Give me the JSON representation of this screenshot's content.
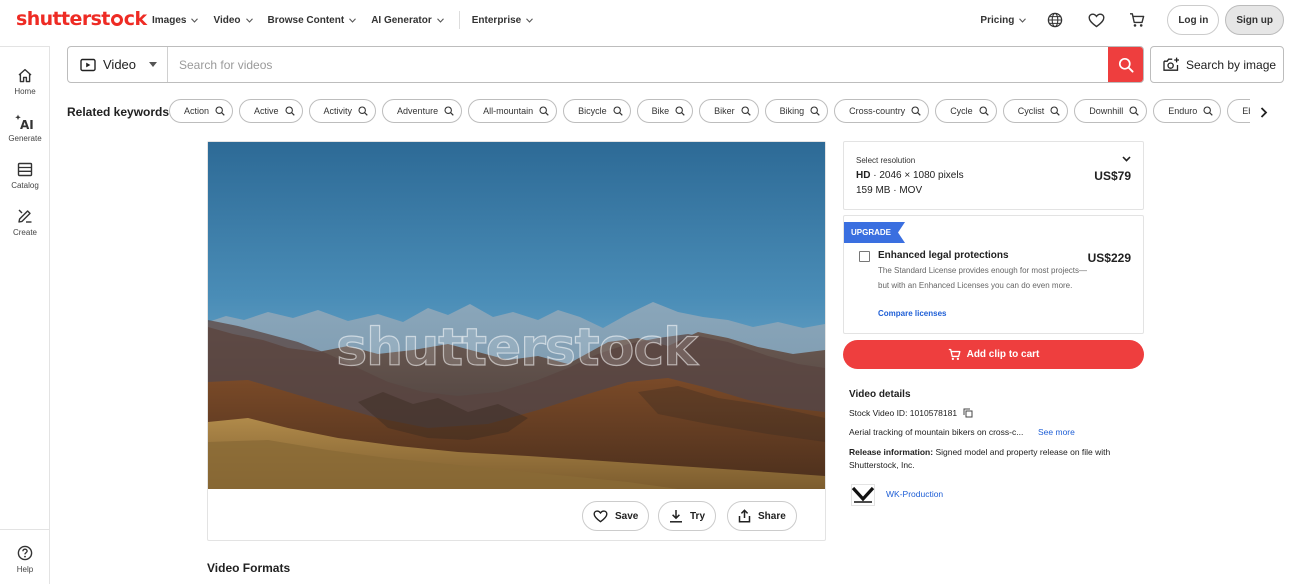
{
  "brand": {
    "logo_before": "shutterst",
    "logo_after": "ck",
    "accent": "#ee2b24"
  },
  "nav": {
    "items": [
      {
        "label": "Images"
      },
      {
        "label": "Video"
      },
      {
        "label": "Browse Content"
      },
      {
        "label": "AI Generator"
      },
      {
        "label": "Enterprise"
      }
    ],
    "pricing": "Pricing",
    "login": "Log in",
    "signup": "Sign up"
  },
  "sidebar": {
    "items": [
      {
        "label": "Home",
        "icon": "home-icon"
      },
      {
        "label": "Generate",
        "icon": "ai-generate-icon"
      },
      {
        "label": "Catalog",
        "icon": "catalog-icon"
      },
      {
        "label": "Create",
        "icon": "create-icon"
      }
    ],
    "help": "Help"
  },
  "search": {
    "media_type": "Video",
    "placeholder": "Search for videos",
    "value": "",
    "by_image": "Search by image"
  },
  "keywords": {
    "label": "Related keywords:",
    "items": [
      "Action",
      "Active",
      "Activity",
      "Adventure",
      "All-mountain",
      "Bicycle",
      "Bike",
      "Biker",
      "Biking",
      "Cross-country",
      "Cycle",
      "Cyclist",
      "Downhill",
      "Enduro",
      "Ebike"
    ]
  },
  "video": {
    "watermark": "shutterstock",
    "actions": {
      "save": "Save",
      "try": "Try",
      "share": "Share"
    }
  },
  "formats_title": "Video Formats",
  "resolution": {
    "label": "Select resolution",
    "quality": "HD",
    "dimensions": " · 2046 × 1080 pixels",
    "details": "159 MB · MOV",
    "price": "US$79"
  },
  "upgrade": {
    "badge": "UPGRADE",
    "title": "Enhanced legal protections",
    "price": "US$229",
    "description": "The Standard License provides enough for most projects—but with an Enhanced Licenses you can do even more.",
    "link": "Compare licenses",
    "checked": false
  },
  "cart": {
    "label": "Add clip to cart",
    "color": "#ee3e3e"
  },
  "details": {
    "title": "Video details",
    "stock_id": "Stock Video ID: 1010578181",
    "description": "Aerial tracking of mountain bikers on cross-c...",
    "see_more": "See more",
    "release_label": "Release information:",
    "release_text": " Signed model and property release on file with Shutterstock, Inc.",
    "contributor": "WK-Production"
  }
}
